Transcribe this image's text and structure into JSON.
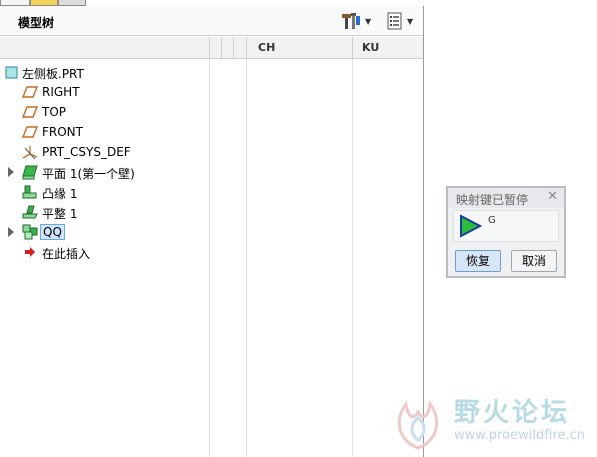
{
  "panel": {
    "title": "模型树"
  },
  "columns": [
    {
      "label": "CH"
    },
    {
      "label": "KU"
    }
  ],
  "tree": [
    {
      "label": "左侧板.PRT",
      "icon": "part-icon",
      "expandable": false,
      "selected": false
    },
    {
      "label": "RIGHT",
      "icon": "datum-plane-icon",
      "expandable": false,
      "selected": false
    },
    {
      "label": "TOP",
      "icon": "datum-plane-icon",
      "expandable": false,
      "selected": false
    },
    {
      "label": "FRONT",
      "icon": "datum-plane-icon",
      "expandable": false,
      "selected": false
    },
    {
      "label": "PRT_CSYS_DEF",
      "icon": "coordinate-system-icon",
      "expandable": false,
      "selected": false
    },
    {
      "label": "平面 1(第一个壁)",
      "icon": "flat-wall-icon",
      "expandable": true,
      "selected": false
    },
    {
      "label": "凸缘 1",
      "icon": "flange-icon",
      "expandable": false,
      "selected": false
    },
    {
      "label": "平整 1",
      "icon": "unbend-icon",
      "expandable": false,
      "selected": false
    },
    {
      "label": "QQ",
      "icon": "group-icon",
      "expandable": true,
      "selected": true
    },
    {
      "label": "在此插入",
      "icon": "insert-here-arrow-icon",
      "expandable": false,
      "selected": false
    }
  ],
  "dialog": {
    "title": "映射键已暂停",
    "letter": "G",
    "resume_label": "恢复",
    "cancel_label": "取消"
  },
  "watermark": {
    "text": "野火论坛",
    "url": "www.proewildfire.cn"
  },
  "colors": {
    "selection": "#cfe6ff",
    "play_green": "#2dbb3a",
    "plane_orange": "#c86a1e"
  }
}
